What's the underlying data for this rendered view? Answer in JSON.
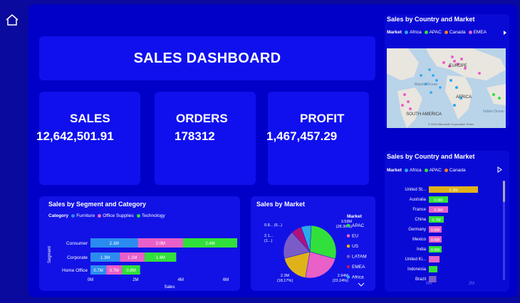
{
  "nav": {
    "home_icon": "home-icon"
  },
  "title": "SALES DASHBOARD",
  "kpis": [
    {
      "label": "SALES",
      "value": "12,642,501.91"
    },
    {
      "label": "ORDERS",
      "value": "178312"
    },
    {
      "label": "PROFIT",
      "value": "1,467,457.29"
    }
  ],
  "segment_chart": {
    "title": "Sales by Segment and Category",
    "legend_title": "Category",
    "legend": [
      "Furniture",
      "Office Supplies",
      "Technology"
    ],
    "colors": [
      "#2b8cf0",
      "#e860c8",
      "#31e03a"
    ],
    "ylabel": "Segment",
    "xlabel": "Sales",
    "xticks": [
      "0M",
      "2M",
      "4M",
      "6M"
    ]
  },
  "market_chart": {
    "title": "Sales by Market",
    "legend_title": "Market",
    "legend": [
      "APAC",
      "EU",
      "US",
      "LATAM",
      "EMEA",
      "Africa"
    ],
    "colors": [
      "#31e03a",
      "#e860c8",
      "#e0b21a",
      "#7a5cc8",
      "#b0127a",
      "#2aa8f0"
    ],
    "labels": [
      {
        "text": "3.59M",
        "sub": "(28.36%)"
      },
      {
        "text": "2.94M",
        "sub": "(23.24%)"
      },
      {
        "text": "2.3M",
        "sub": "(18.17%)"
      },
      {
        "text": "2.1...",
        "sub": "(1...)"
      },
      {
        "text": "0.8... (6...)",
        "sub": ""
      }
    ]
  },
  "map_panel": {
    "title": "Sales by Country and Market",
    "legend_title": "Market",
    "legend": [
      "Africa",
      "APAC",
      "Canada",
      "EMEA"
    ],
    "colors": [
      "#2aa8f0",
      "#31e03a",
      "#f07a2a",
      "#e860c8"
    ],
    "map_labels": [
      "EUROPE",
      "Atlantic Ocean",
      "AFRICA",
      "SOUTH AMERICA",
      "Indian Ocean"
    ],
    "attribution": "© 2024 Microsoft Corporation Terms"
  },
  "country_panel": {
    "title": "Sales by Country and Market",
    "legend_title": "Market",
    "legend": [
      "Africa",
      "APAC",
      "Canada"
    ],
    "colors": [
      "#2aa8f0",
      "#31e03a",
      "#f07a2a"
    ],
    "countries": [
      "United St...",
      "Australia",
      "France",
      "China",
      "Germany",
      "Mexico",
      "India",
      "United Ki...",
      "Indonesia",
      "Brazil"
    ],
    "value_labels": [
      "2.3M",
      "0.9M",
      "0.9M",
      "0.7M",
      "0.6M",
      "0.6M",
      "0.6M",
      "",
      "",
      ""
    ],
    "xticks": [
      "0M",
      "2M"
    ]
  },
  "chart_data": [
    {
      "type": "bar",
      "orientation": "horizontal",
      "stacked": true,
      "title": "Sales by Segment and Category",
      "categories": [
        "Consumer",
        "Corporate",
        "Home Office"
      ],
      "series": [
        {
          "name": "Furniture",
          "values": [
            2.1,
            1.3,
            0.7
          ]
        },
        {
          "name": "Office Supplies",
          "values": [
            2.0,
            1.1,
            0.7
          ]
        },
        {
          "name": "Technology",
          "values": [
            2.4,
            1.4,
            0.8
          ]
        }
      ],
      "value_labels": [
        [
          "2.1M",
          "2.0M",
          "2.4M"
        ],
        [
          "1.3M",
          "1.1M",
          "1.4M"
        ],
        [
          "0.7M",
          "0.7M",
          "0.8M"
        ]
      ],
      "xlabel": "Sales",
      "ylabel": "Segment",
      "xlim": [
        0,
        6.5
      ],
      "legend": "top-left"
    },
    {
      "type": "pie",
      "donut": false,
      "title": "Sales by Market",
      "categories": [
        "APAC",
        "EU",
        "US",
        "LATAM",
        "EMEA",
        "Africa"
      ],
      "values": [
        3.59,
        2.94,
        2.3,
        2.16,
        0.81,
        0.78
      ],
      "legend": "right"
    },
    {
      "type": "bar",
      "orientation": "horizontal",
      "title": "Sales by Country and Market",
      "categories": [
        "United St...",
        "Australia",
        "France",
        "China",
        "Germany",
        "Mexico",
        "India",
        "United Ki...",
        "Indonesia",
        "Brazil"
      ],
      "values": [
        2.3,
        0.9,
        0.9,
        0.7,
        0.6,
        0.6,
        0.6,
        0.5,
        0.4,
        0.35
      ],
      "colors": [
        "#e0b21a",
        "#31e03a",
        "#e860c8",
        "#31e03a",
        "#e860c8",
        "#e860c8",
        "#31e03a",
        "#e860c8",
        "#31e03a",
        "#7a5cc8"
      ],
      "xlim": [
        0,
        2.5
      ],
      "legend": "top-left"
    }
  ]
}
